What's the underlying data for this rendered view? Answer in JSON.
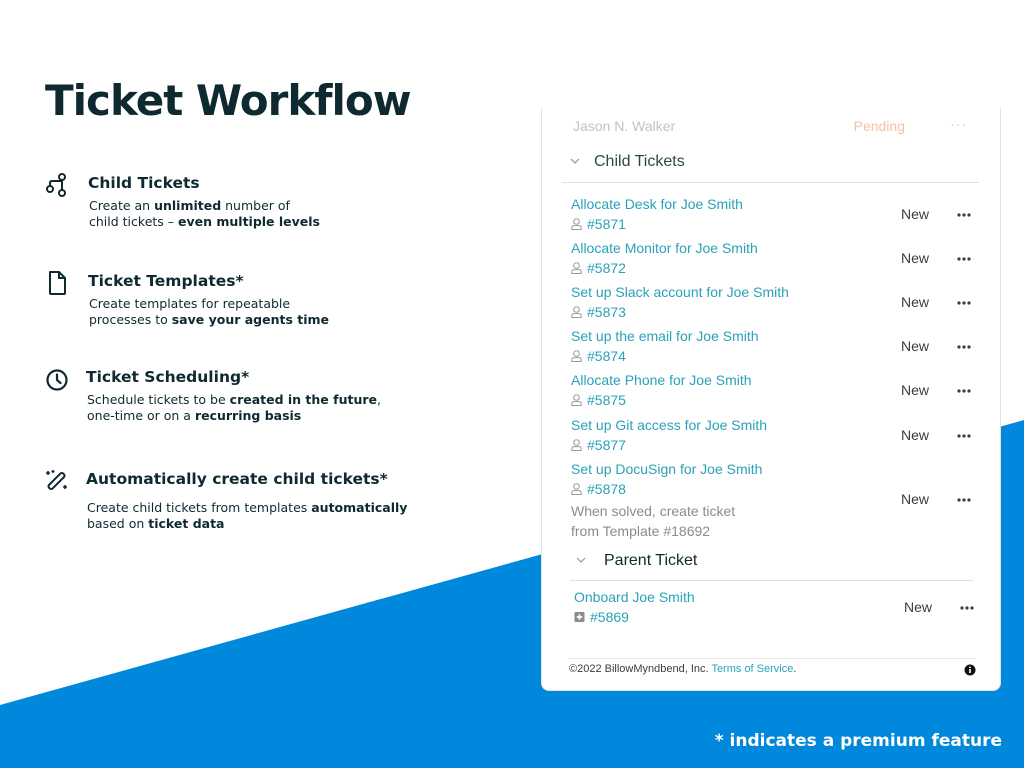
{
  "slide": {
    "title": "Ticket Workflow",
    "footnote": "* indicates a premium feature",
    "colors": {
      "accent_blue": "#0088dd",
      "text_dark": "#0e2a30",
      "link_teal": "#2aa2b9"
    }
  },
  "features": [
    {
      "icon": "branch-icon",
      "title": "Child Tickets",
      "desc": [
        [
          {
            "t": "Create an ",
            "b": false
          },
          {
            "t": "unlimited",
            "b": true
          },
          {
            "t": " number of",
            "b": false
          }
        ],
        [
          {
            "t": "child tickets – ",
            "b": false
          },
          {
            "t": "even multiple levels",
            "b": true
          }
        ]
      ]
    },
    {
      "icon": "document-icon",
      "title": "Ticket Templates*",
      "desc": [
        [
          {
            "t": "Create templates for repeatable",
            "b": false
          }
        ],
        [
          {
            "t": "processes to ",
            "b": false
          },
          {
            "t": "save your agents time",
            "b": true
          }
        ]
      ]
    },
    {
      "icon": "clock-icon",
      "title": "Ticket Scheduling*",
      "desc": [
        [
          {
            "t": "Schedule tickets to be ",
            "b": false
          },
          {
            "t": "created in the future",
            "b": true
          },
          {
            "t": ",",
            "b": false
          }
        ],
        [
          {
            "t": "one-time or on a ",
            "b": false
          },
          {
            "t": "recurring basis",
            "b": true
          }
        ]
      ]
    },
    {
      "icon": "magic-wand-icon",
      "title": "Automatically create child tickets*",
      "desc": [
        [
          {
            "t": "Create child tickets from templates ",
            "b": false
          },
          {
            "t": "automatically",
            "b": true
          }
        ],
        [
          {
            "t": "based on ",
            "b": false
          },
          {
            "t": "ticket data",
            "b": true
          }
        ]
      ]
    }
  ],
  "card": {
    "faded_row": {
      "name": "Jason N. Walker",
      "status": "Pending",
      "more": "···"
    },
    "child_section": {
      "label": "Child Tickets",
      "tickets": [
        {
          "name": "Allocate Desk for Joe Smith",
          "id": "#5871",
          "status": "New"
        },
        {
          "name": "Allocate Monitor for Joe Smith",
          "id": "#5872",
          "status": "New"
        },
        {
          "name": "Set up Slack account for Joe Smith",
          "id": "#5873",
          "status": "New"
        },
        {
          "name": "Set up the email for Joe Smith",
          "id": "#5874",
          "status": "New"
        },
        {
          "name": "Allocate Phone for Joe Smith",
          "id": "#5875",
          "status": "New"
        },
        {
          "name": "Set up Git access for Joe Smith",
          "id": "#5877",
          "status": "New"
        },
        {
          "name": "Set up DocuSign for Joe Smith",
          "id": "#5878",
          "status": "New",
          "note": [
            "When solved, create ticket",
            "from Template #18692"
          ]
        }
      ]
    },
    "parent_section": {
      "label": "Parent Ticket",
      "ticket": {
        "name": "Onboard Joe Smith",
        "id": "#5869",
        "status": "New"
      }
    },
    "footer": {
      "copyright": "©2022 BillowMyndbend, Inc. ",
      "terms_link": "Terms of Service",
      "terms_suffix": "."
    }
  }
}
